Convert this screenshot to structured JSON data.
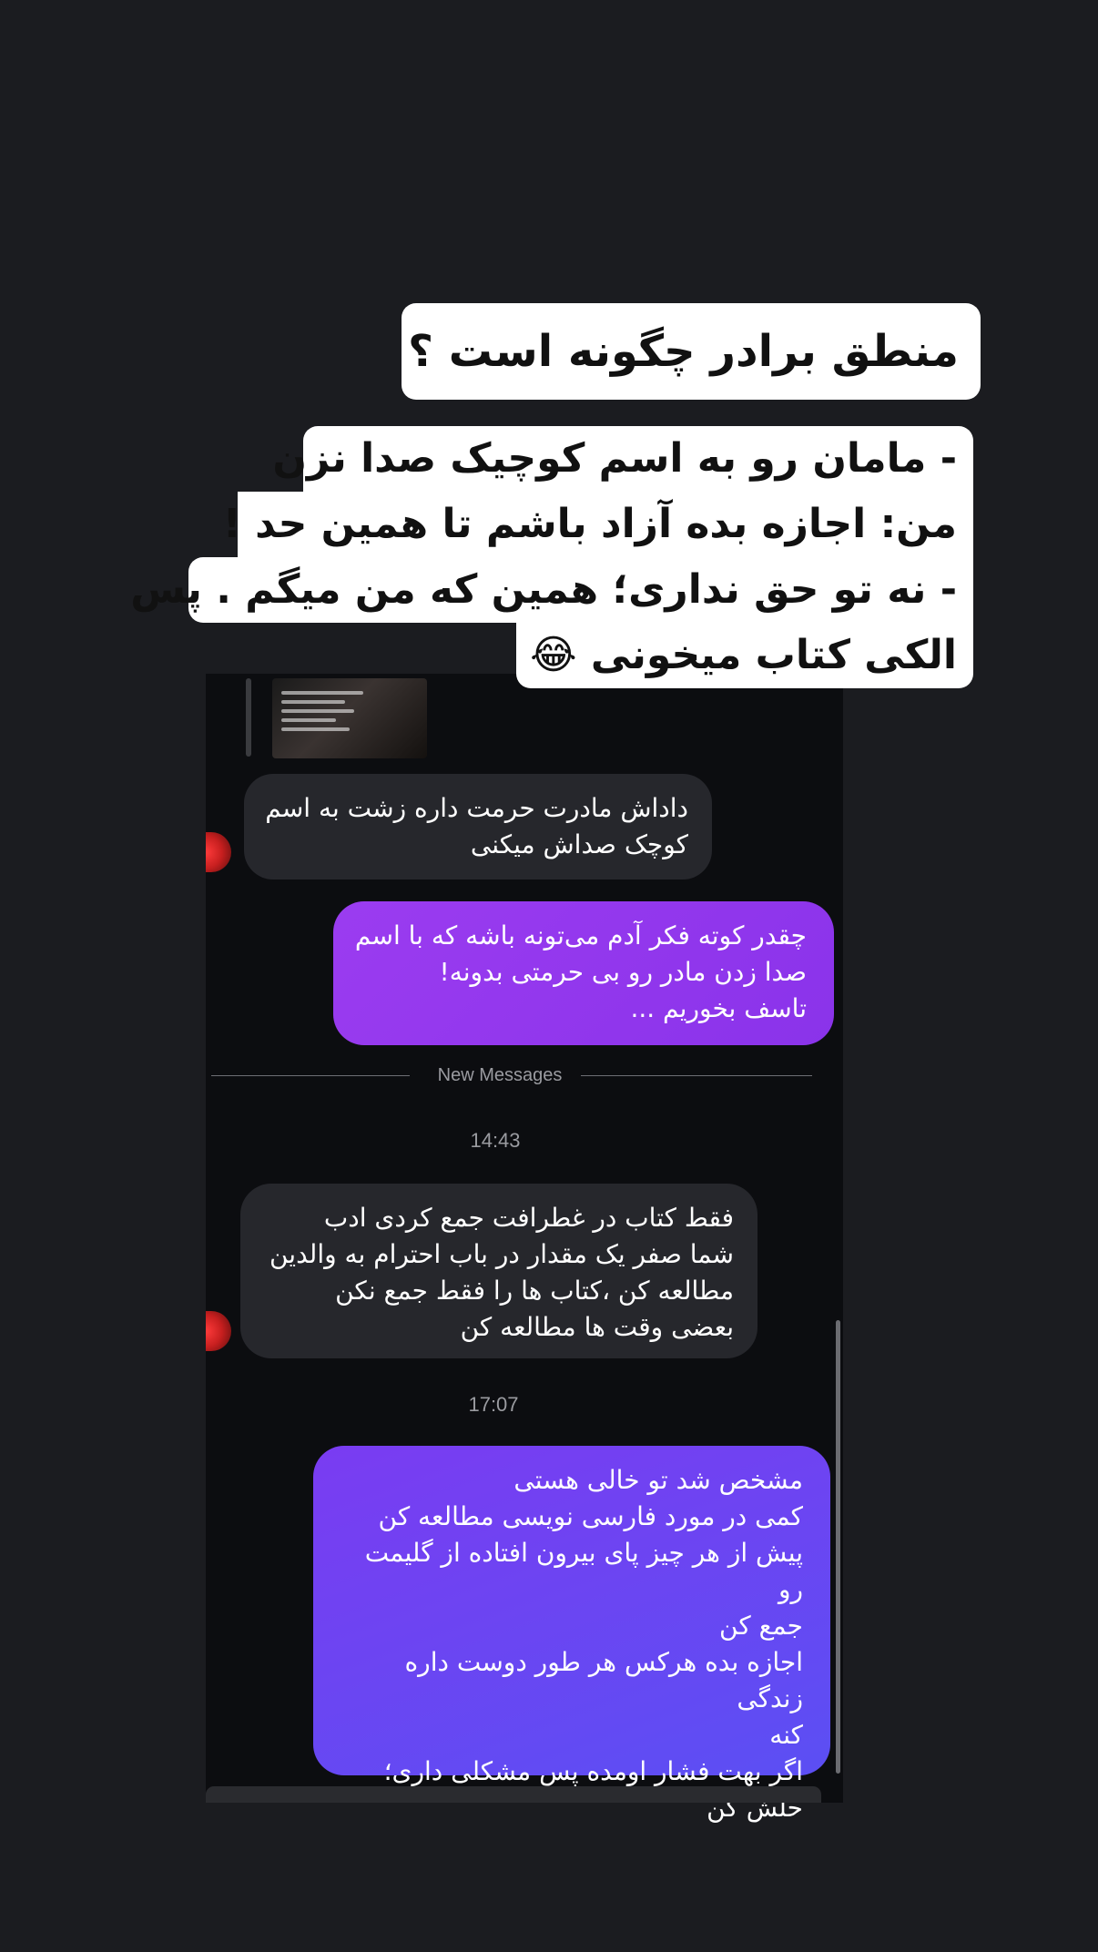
{
  "title_card": {
    "text": "منطق برادر چگونه است ؟"
  },
  "caption": {
    "lines": [
      "- مامان رو به اسم کوچیک صدا نزن",
      "من: اجازه  بده آزاد باشم تا همین حد !",
      "- نه تو حق نداری؛ همین که من میگم . پس",
      "الکی کتاب میخونی 😂"
    ]
  },
  "chat": {
    "divider_label": "New Messages",
    "messages": [
      {
        "direction": "incoming",
        "text": "داداش مادرت حرمت داره زشت به اسم\nکوچک صداش میکنی"
      },
      {
        "direction": "outgoing",
        "text": "چقدر کوته فکر آدم می‌تونه باشه که با اسم\nصدا زدن مادر رو بی حرمتی بدونه!\nتاسف بخوریم ..."
      },
      {
        "direction": "incoming",
        "text": "فقط کتاب در غطرافت  جمع کردی ادب\nشما صفر یک مقدار در باب احترام به والدین\nمطالعه کن ،کتاب ها را فقط جمع نکن\nبعضی وقت ها مطالعه کن"
      },
      {
        "direction": "outgoing",
        "text": "مشخص شد تو خالی هستی\nکمی در مورد فارسی نویسی مطالعه کن\nپیش از هر چیز پای بیرون افتاده از گلیمت رو\nجمع کن\nاجازه بده هرکس هر طور دوست داره زندگی\nکنه\nاگر بهت فشار اومده پس مشکلی داری؛\nحلش کن"
      }
    ],
    "timestamps": [
      "14:43",
      "17:07"
    ]
  }
}
